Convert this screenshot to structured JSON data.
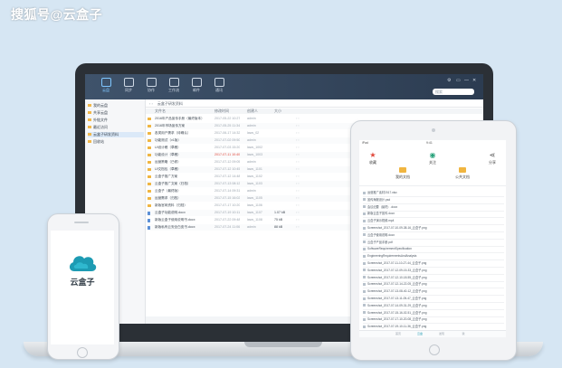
{
  "watermark": "搜狐号@云盒子",
  "desktop": {
    "toolbar": [
      {
        "label": "云盘",
        "icon": "folder-icon",
        "active": true
      },
      {
        "label": "同步",
        "icon": "sync-icon",
        "active": false
      },
      {
        "label": "协作",
        "icon": "chat-icon",
        "active": false
      },
      {
        "label": "工作流",
        "icon": "edit-icon",
        "active": false
      },
      {
        "label": "邮件",
        "icon": "mail-icon",
        "active": false
      },
      {
        "label": "通讯",
        "icon": "clock-icon",
        "active": false
      }
    ],
    "window_controls": [
      "⚙",
      "▭",
      "—",
      "✕"
    ],
    "search_placeholder": "搜索",
    "sidebar": [
      {
        "label": "我的云盘",
        "selected": false
      },
      {
        "label": "共享云盘",
        "selected": false
      },
      {
        "label": "外链文件",
        "selected": false
      },
      {
        "label": "最近访问",
        "selected": false
      },
      {
        "label": "云盒子研发资料",
        "selected": true
      },
      {
        "label": "回收站",
        "selected": false
      }
    ],
    "path": "云盒子研发资料",
    "columns": [
      "文件名",
      "修改时间",
      "创建人",
      "大小"
    ],
    "rows": [
      {
        "type": "folder",
        "name": "2016年产品宣传手册（最终版本）",
        "time": "2017-05-22 10:27",
        "owner": "admin",
        "size": "",
        "red": false
      },
      {
        "type": "folder",
        "name": "2016年市场宣传方案",
        "time": "2017-05-25 11:34",
        "owner": "admin",
        "size": "",
        "red": false
      },
      {
        "type": "folder",
        "name": "各类用户需求（待确认）",
        "time": "2017-06-17 14:32",
        "owner": "laws_02",
        "size": "",
        "red": false
      },
      {
        "type": "folder",
        "name": "功能测试（v1版）",
        "time": "2017-07-02 09:50",
        "owner": "admin",
        "size": "",
        "red": false
      },
      {
        "type": "folder",
        "name": "UI设计稿（草稿）",
        "time": "2017-07-03 15:20",
        "owner": "laws_1002",
        "size": "",
        "red": false
      },
      {
        "type": "folder",
        "name": "功能设计（草稿）",
        "time": "2017-07-11 10:40",
        "owner": "laws_1003",
        "size": "",
        "red": true
      },
      {
        "type": "folder",
        "name": "运营策略（已修）",
        "time": "2017-07-12 09:05",
        "owner": "admin",
        "size": "",
        "red": false
      },
      {
        "type": "folder",
        "name": "UI文档包（草稿）",
        "time": "2017-07-12 10:45",
        "owner": "laws_1101",
        "size": "",
        "red": false
      },
      {
        "type": "folder",
        "name": "云盒子推广方案",
        "time": "2017-07-12 14:48",
        "owner": "laws_1102",
        "size": "",
        "red": false
      },
      {
        "type": "folder",
        "name": "云盒子推广文案（归档）",
        "time": "2017-07-13 08:12",
        "owner": "laws_1103",
        "size": "",
        "red": false
      },
      {
        "type": "folder",
        "name": "云盒子（最终版）",
        "time": "2017-07-14 09:31",
        "owner": "admin",
        "size": "",
        "red": false
      },
      {
        "type": "folder",
        "name": "运营需求（归档）",
        "time": "2017-07-15 16:02",
        "owner": "laws_1105",
        "size": "",
        "red": false
      },
      {
        "type": "folder",
        "name": "新版官网资料（归档）",
        "time": "2017-07-17 10:20",
        "owner": "laws_1106",
        "size": "",
        "red": false
      },
      {
        "type": "doc",
        "name": "云盒子功能说明.docx",
        "time": "2017-07-19 10:11",
        "owner": "laws_1107",
        "size": "1.07 kB",
        "red": false
      },
      {
        "type": "doc",
        "name": "新版云盒子使用说明书.docx",
        "time": "2017-07-22 09:48",
        "owner": "laws_1108",
        "size": "75 kB",
        "red": false
      },
      {
        "type": "doc",
        "name": "新版私有云安全白皮书.docx",
        "time": "2017-07-24 11:06",
        "owner": "admin",
        "size": "88 kB",
        "red": false
      }
    ]
  },
  "tablet": {
    "status_left": "iPad",
    "status_time": "9:41",
    "actions": [
      {
        "label": "收藏",
        "glyph": "★",
        "color": "#e0473a",
        "icon": "star-icon"
      },
      {
        "label": "关注",
        "glyph": "◉",
        "color": "#27a17a",
        "icon": "eye-icon"
      },
      {
        "label": "分享",
        "glyph": "⋖",
        "color": "#555555",
        "icon": "share-icon"
      }
    ],
    "folders": [
      "我的文档",
      "公共文档"
    ],
    "files": [
      "运营推广素材2017.xlsx",
      "宣传海报设计.psd",
      "会议纪要（最终）.docx",
      "新版云盒子宣传.docx",
      "云盒子演示视频.mp4",
      "Screenshot_2017-07-10-09-38-16_云盒子.png",
      "云盒子使用说明.docx",
      "云盒子产品手册.pdf",
      "SoftwareRequirementSpecification",
      "EngineeringRequirementsAndAnalysis",
      "Screenshot_2017-07-11-10-27-44_云盒子.png",
      "Screenshot_2017-07-12-09-15-33_云盒子.png",
      "Screenshot_2017-07-12-10-18-55_云盒子.png",
      "Screenshot_2017-07-12-14-22-05_云盒子.png",
      "Screenshot_2017-07-13-08-40-12_云盒子.png",
      "Screenshot_2017-07-13-11-05-47_云盒子.png",
      "Screenshot_2017-07-14-09-31-29_云盒子.png",
      "Screenshot_2017-07-15-16-02-51_云盒子.png",
      "Screenshot_2017-07-17-10-20-08_云盒子.png",
      "Screenshot_2017-07-19-10-11-36_云盒子.png"
    ],
    "tabs": [
      "首页",
      "云盘",
      "发现",
      "我"
    ]
  },
  "phone": {
    "app_name": "云盒子",
    "brand_color": "#1d9bb3"
  }
}
